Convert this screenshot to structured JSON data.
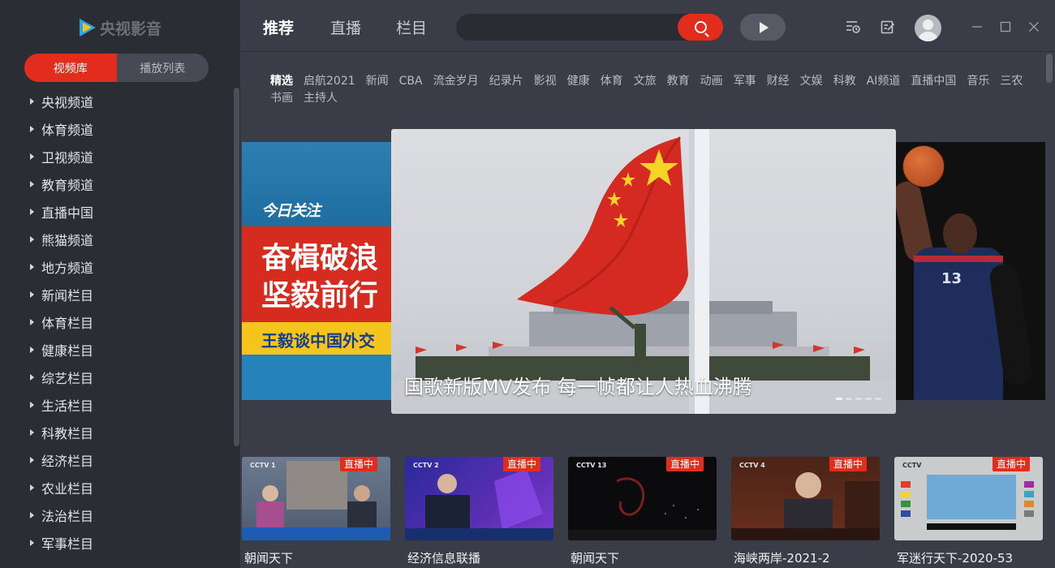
{
  "app": {
    "logo_text": "央视影音"
  },
  "sidebar": {
    "tabs": [
      {
        "label": "视频库",
        "active": true
      },
      {
        "label": "播放列表",
        "active": false
      }
    ],
    "categories": [
      "央视频道",
      "体育频道",
      "卫视频道",
      "教育频道",
      "直播中国",
      "熊猫频道",
      "地方频道",
      "新闻栏目",
      "体育栏目",
      "健康栏目",
      "综艺栏目",
      "生活栏目",
      "科教栏目",
      "经济栏目",
      "农业栏目",
      "法治栏目",
      "军事栏目"
    ]
  },
  "topbar": {
    "tabs": [
      {
        "label": "推荐",
        "active": true
      },
      {
        "label": "直播",
        "active": false
      },
      {
        "label": "栏目",
        "active": false
      }
    ],
    "search": {
      "value": "",
      "placeholder": ""
    }
  },
  "channels": [
    "精选",
    "启航2021",
    "新闻",
    "CBA",
    "流金岁月",
    "纪录片",
    "影视",
    "健康",
    "体育",
    "文旅",
    "教育",
    "动画",
    "军事",
    "财经",
    "文娱",
    "科教",
    "AI频道",
    "直播中国",
    "音乐",
    "三农",
    "书画",
    "主持人"
  ],
  "carousel": {
    "left_slide": {
      "brand": "今日关注",
      "line1": "奋楫破浪",
      "line2": "坚毅前行",
      "line3": "王毅谈中国外交"
    },
    "main_slide": {
      "caption": "国歌新版MV发布 每一帧都让人热血沸腾"
    },
    "right_slide": {
      "jersey_number": "13"
    }
  },
  "live_badge": "直播中",
  "thumbnails": [
    {
      "title": "朝闻天下",
      "logo": "CCTV 1"
    },
    {
      "title": "经济信息联播",
      "logo": "CCTV 2"
    },
    {
      "title": "朝闻天下",
      "logo": "CCTV 13"
    },
    {
      "title": "海峡两岸-2021-2",
      "logo": "CCTV 4"
    },
    {
      "title": "军迷行天下-2020-53",
      "logo": "CCTV"
    }
  ],
  "colors": {
    "accent": "#e22d1c",
    "sidebar_bg": "#2b2d34",
    "main_bg": "#3a3d47"
  }
}
